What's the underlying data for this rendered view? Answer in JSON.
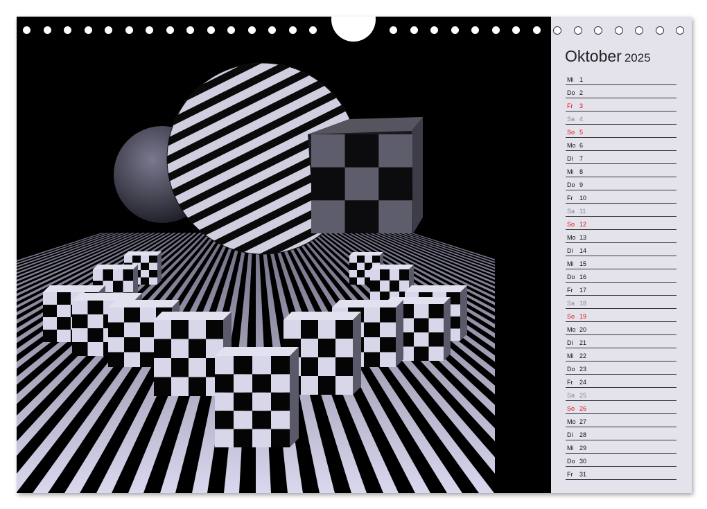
{
  "calendar": {
    "month": "Oktober",
    "year": "2025",
    "days": [
      {
        "wd": "Mi",
        "d": "1",
        "type": "work"
      },
      {
        "wd": "Do",
        "d": "2",
        "type": "work"
      },
      {
        "wd": "Fr",
        "d": "3",
        "type": "holiday"
      },
      {
        "wd": "Sa",
        "d": "4",
        "type": "sat"
      },
      {
        "wd": "So",
        "d": "5",
        "type": "sun"
      },
      {
        "wd": "Mo",
        "d": "6",
        "type": "work"
      },
      {
        "wd": "Di",
        "d": "7",
        "type": "work"
      },
      {
        "wd": "Mi",
        "d": "8",
        "type": "work"
      },
      {
        "wd": "Do",
        "d": "9",
        "type": "work"
      },
      {
        "wd": "Fr",
        "d": "10",
        "type": "work"
      },
      {
        "wd": "Sa",
        "d": "11",
        "type": "sat"
      },
      {
        "wd": "So",
        "d": "12",
        "type": "sun"
      },
      {
        "wd": "Mo",
        "d": "13",
        "type": "work"
      },
      {
        "wd": "Di",
        "d": "14",
        "type": "work"
      },
      {
        "wd": "Mi",
        "d": "15",
        "type": "work"
      },
      {
        "wd": "Do",
        "d": "16",
        "type": "work"
      },
      {
        "wd": "Fr",
        "d": "17",
        "type": "work"
      },
      {
        "wd": "Sa",
        "d": "18",
        "type": "sat"
      },
      {
        "wd": "So",
        "d": "19",
        "type": "sun"
      },
      {
        "wd": "Mo",
        "d": "20",
        "type": "work"
      },
      {
        "wd": "Di",
        "d": "21",
        "type": "work"
      },
      {
        "wd": "Mi",
        "d": "22",
        "type": "work"
      },
      {
        "wd": "Do",
        "d": "23",
        "type": "work"
      },
      {
        "wd": "Fr",
        "d": "24",
        "type": "work"
      },
      {
        "wd": "Sa",
        "d": "25",
        "type": "sat"
      },
      {
        "wd": "So",
        "d": "26",
        "type": "sun"
      },
      {
        "wd": "Mo",
        "d": "27",
        "type": "work"
      },
      {
        "wd": "Di",
        "d": "28",
        "type": "work"
      },
      {
        "wd": "Mi",
        "d": "29",
        "type": "work"
      },
      {
        "wd": "Do",
        "d": "30",
        "type": "work"
      },
      {
        "wd": "Fr",
        "d": "31",
        "type": "work"
      }
    ]
  },
  "colors": {
    "background": "#000000",
    "sidebar": "#e4e3ec",
    "holiday": "#dd1111",
    "saturday": "#888888",
    "stripe_light": "#c9c8e0"
  },
  "artwork": {
    "description_icons": [
      "striped-sphere",
      "plain-sphere",
      "checkered-cube",
      "checkered-blocks",
      "striped-floor"
    ]
  }
}
